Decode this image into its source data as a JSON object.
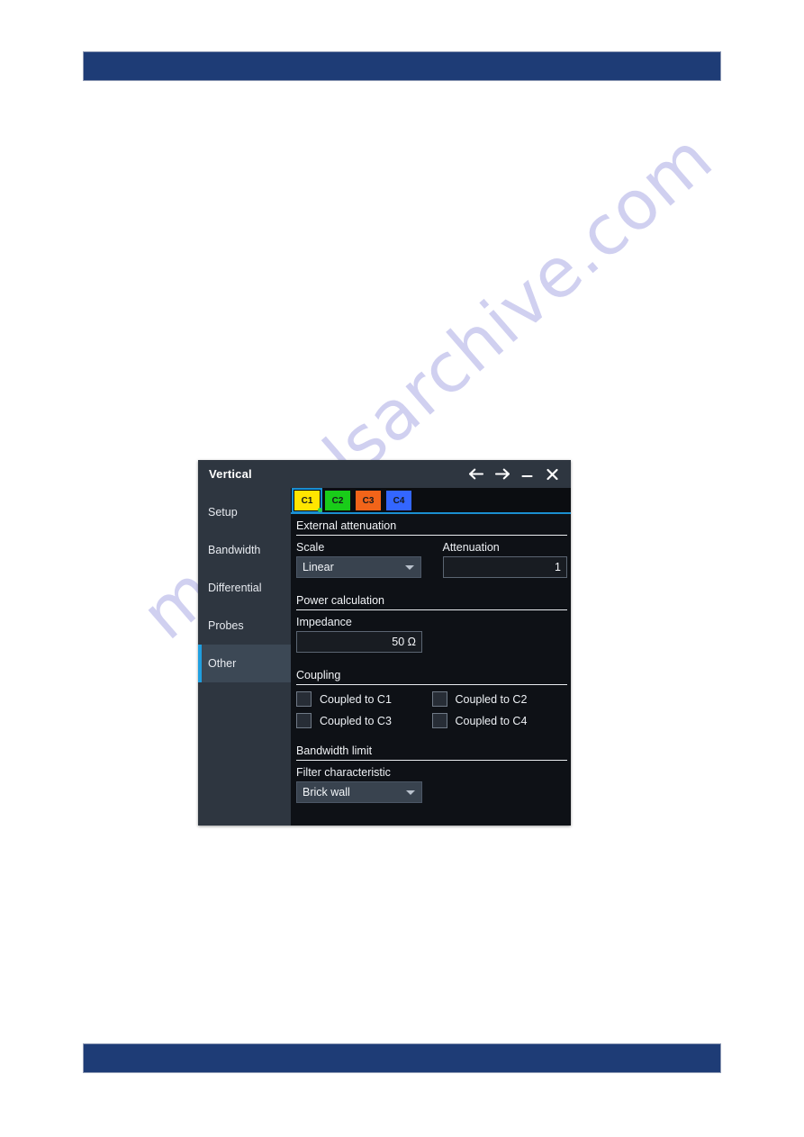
{
  "page": {
    "header_bar_color": "#1e3c76",
    "footer_bar_color": "#1e3c76",
    "watermark_text": "manualsarchive.com"
  },
  "dialog": {
    "title": "Vertical",
    "titlebar_buttons": [
      {
        "name": "back-arrow-icon",
        "glyph": "←"
      },
      {
        "name": "forward-arrow-icon",
        "glyph": "→"
      },
      {
        "name": "minimize-icon",
        "glyph": "–"
      },
      {
        "name": "close-icon",
        "glyph": "✕"
      }
    ],
    "sidebar": {
      "items": [
        {
          "label": "Setup",
          "selected": false
        },
        {
          "label": "Bandwidth",
          "selected": false
        },
        {
          "label": "Differential",
          "selected": false
        },
        {
          "label": "Probes",
          "selected": false
        },
        {
          "label": "Other",
          "selected": true
        }
      ],
      "accent_color": "#1f9fe0"
    },
    "channel_tabs": [
      {
        "label": "C1",
        "color": "#ffe500",
        "selected": true,
        "active_dot": true
      },
      {
        "label": "C2",
        "color": "#19cc19",
        "selected": false,
        "active_dot": false
      },
      {
        "label": "C3",
        "color": "#f26419",
        "selected": false,
        "active_dot": false
      },
      {
        "label": "C4",
        "color": "#3366ff",
        "selected": false,
        "active_dot": false
      }
    ],
    "sections": {
      "external_attenuation": {
        "heading": "External attenuation",
        "scale": {
          "label": "Scale",
          "value": "Linear"
        },
        "attenuation": {
          "label": "Attenuation",
          "value": "1"
        }
      },
      "power_calculation": {
        "heading": "Power calculation",
        "impedance": {
          "label": "Impedance",
          "value": "50 Ω"
        }
      },
      "coupling": {
        "heading": "Coupling",
        "checkboxes": [
          {
            "label": "Coupled to C1",
            "checked": false
          },
          {
            "label": "Coupled to C2",
            "checked": false
          },
          {
            "label": "Coupled to C3",
            "checked": false
          },
          {
            "label": "Coupled to C4",
            "checked": false
          }
        ]
      },
      "bandwidth_limit": {
        "heading": "Bandwidth limit",
        "filter_characteristic": {
          "label": "Filter characteristic",
          "value": "Brick wall"
        }
      }
    }
  }
}
